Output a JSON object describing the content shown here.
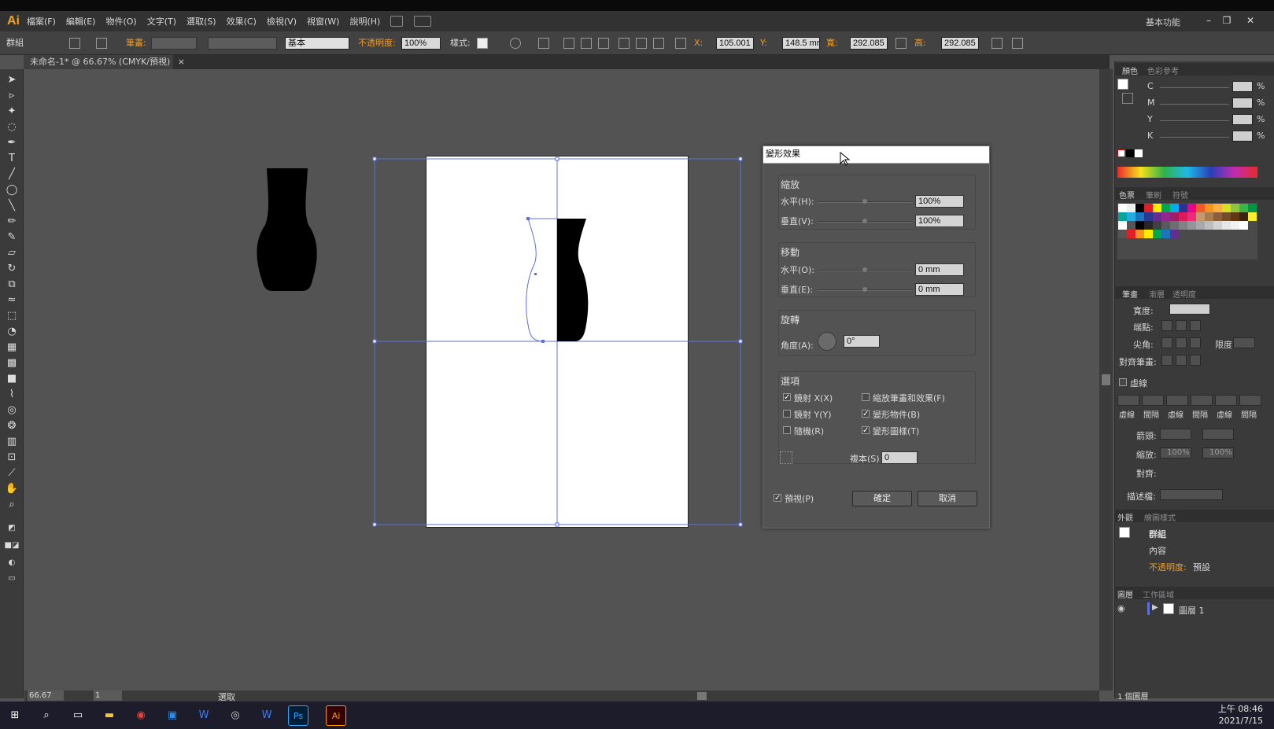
{
  "app": {
    "logo": "Ai",
    "menus": [
      "檔案(F)",
      "編輯(E)",
      "物件(O)",
      "文字(T)",
      "選取(S)",
      "效果(C)",
      "檢視(V)",
      "視窗(W)",
      "說明(H)"
    ],
    "workspace": "基本功能"
  },
  "control_bar": {
    "selection_type": "群組",
    "stroke_label": "筆畫:",
    "stroke_style": "基本",
    "opacity_label": "不透明度:",
    "opacity_value": "100%",
    "style_label": "樣式:",
    "x_label": "X:",
    "x_value": "105.001",
    "y_label": "Y:",
    "y_value": "148.5 mr",
    "w_label": "寬:",
    "w_value": "292.085",
    "h_label": "高:",
    "h_value": "292.085"
  },
  "document_tab": {
    "title": "未命名-1* @ 66.67% (CMYK/預視)",
    "close": "×"
  },
  "dialog": {
    "title": "變形效果",
    "scale": {
      "heading": "縮放",
      "h_label": "水平(H):",
      "h_value": "100%",
      "v_label": "垂直(V):",
      "v_value": "100%"
    },
    "move": {
      "heading": "移動",
      "h_label": "水平(O):",
      "h_value": "0 mm",
      "v_label": "垂直(E):",
      "v_value": "0 mm"
    },
    "rotate": {
      "heading": "旋轉",
      "angle_label": "角度(A):",
      "angle_value": "0°"
    },
    "options": {
      "heading": "選項",
      "reflect_x": "鏡射 X(X)",
      "reflect_x_checked": true,
      "reflect_y": "鏡射 Y(Y)",
      "reflect_y_checked": false,
      "random": "隨機(R)",
      "random_checked": false,
      "scale_strokes": "縮放筆畫和效果(F)",
      "scale_strokes_checked": false,
      "transform_objects": "變形物件(B)",
      "transform_objects_checked": true,
      "transform_patterns": "變形圖樣(T)",
      "transform_patterns_checked": true,
      "copies_label": "複本(S)",
      "copies_value": "0"
    },
    "preview_label": "預視(P)",
    "preview_checked": true,
    "ok_label": "確定",
    "cancel_label": "取消"
  },
  "panels": {
    "color_tabs": [
      "顏色",
      "色彩參考"
    ],
    "cmyk": [
      "C",
      "M",
      "Y",
      "K"
    ],
    "percent": "%",
    "swatch_tabs": [
      "色票",
      "筆刷",
      "符號"
    ],
    "stroke_tabs": [
      "筆畫",
      "漸層",
      "透明度"
    ],
    "stroke_width_label": "寬度:",
    "cap_label": "端點:",
    "corner_label": "尖角:",
    "limit_label": "限度:",
    "align_label": "對齊筆畫:",
    "dashed_label": "虛線",
    "dash_cols": [
      "虛線",
      "間隔",
      "虛線",
      "間隔",
      "虛線",
      "間隔"
    ],
    "arrow_label": "箭頭:",
    "scale_label": "縮放:",
    "scale_value1": "100%",
    "scale_value2": "100%",
    "align2_label": "對齊:",
    "profile_label": "描述檔:",
    "appearance_tabs": [
      "外觀",
      "繪圖樣式"
    ],
    "appearance_group": "群組",
    "appearance_contents": "內容",
    "appearance_opacity": "不透明度:",
    "appearance_opacity_value": "預設",
    "layers_tabs": [
      "圖層",
      "工作區域"
    ],
    "layer_name": "圖層 1",
    "layer_count": "1 個圖層"
  },
  "status": {
    "zoom": "66.67",
    "artboard": "1",
    "status_text": "選取"
  },
  "taskbar": {
    "time": "上午 08:46",
    "date": "2021/7/15",
    "ps": "Ps",
    "ai": "Ai"
  },
  "colors": {
    "ai_orange": "#f7a21b",
    "selection_blue": "#5b6fe0",
    "label_orange": "#f29c23"
  }
}
